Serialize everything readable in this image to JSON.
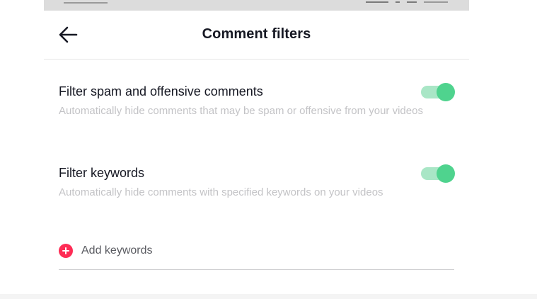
{
  "header": {
    "title": "Comment filters",
    "back_icon": "arrow-left-icon"
  },
  "settings": [
    {
      "title": "Filter spam and offensive comments",
      "description": "Automatically hide comments that may be spam or offensive from your videos",
      "enabled": true
    },
    {
      "title": "Filter keywords",
      "description": "Automatically hide comments with specified keywords on your videos",
      "enabled": true
    }
  ],
  "add_keywords": {
    "label": "Add keywords",
    "icon": "plus-circle-icon"
  },
  "colors": {
    "toggle_on": "#4fd38e",
    "toggle_track": "#a9e6c6",
    "accent": "#fe2c55",
    "text_primary": "#161823",
    "text_secondary": "#c3c3c6"
  }
}
